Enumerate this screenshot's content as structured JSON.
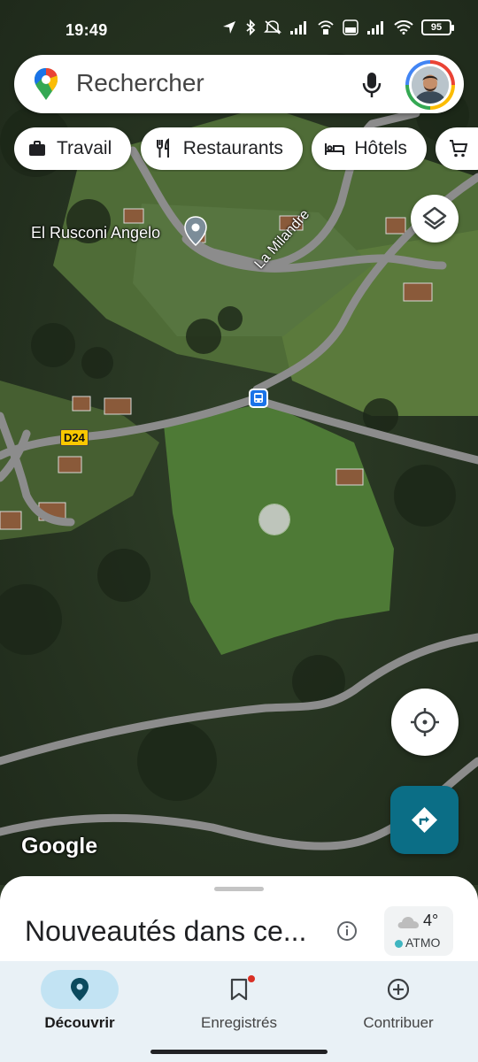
{
  "status_bar": {
    "time": "19:49",
    "battery": "95"
  },
  "search": {
    "placeholder": "Rechercher"
  },
  "chips": [
    {
      "label": "Travail",
      "icon": "briefcase-icon"
    },
    {
      "label": "Restaurants",
      "icon": "fork-knife-icon"
    },
    {
      "label": "Hôtels",
      "icon": "bed-icon"
    },
    {
      "label": "",
      "icon": "shopping-cart-icon"
    }
  ],
  "map": {
    "place_label": "El Rusconi Angelo",
    "road_label_1": "La Milandre",
    "road_badge": "D24",
    "watermark": "Google",
    "road_color": "#8c8c8c"
  },
  "sheet": {
    "title": "Nouveautés dans ce...",
    "weather_temp": "4°",
    "weather_atmo": "ATMO"
  },
  "nav": {
    "items": [
      {
        "label": "Découvrir",
        "icon": "location-pin-icon",
        "active": true
      },
      {
        "label": "Enregistrés",
        "icon": "bookmark-icon",
        "active": false
      },
      {
        "label": "Contribuer",
        "icon": "add-circle-icon",
        "active": false
      }
    ]
  },
  "colors": {
    "accent": "#0b6e86",
    "nav_bg": "#e9f1f6",
    "nav_active_pill": "#c2e3f3"
  }
}
